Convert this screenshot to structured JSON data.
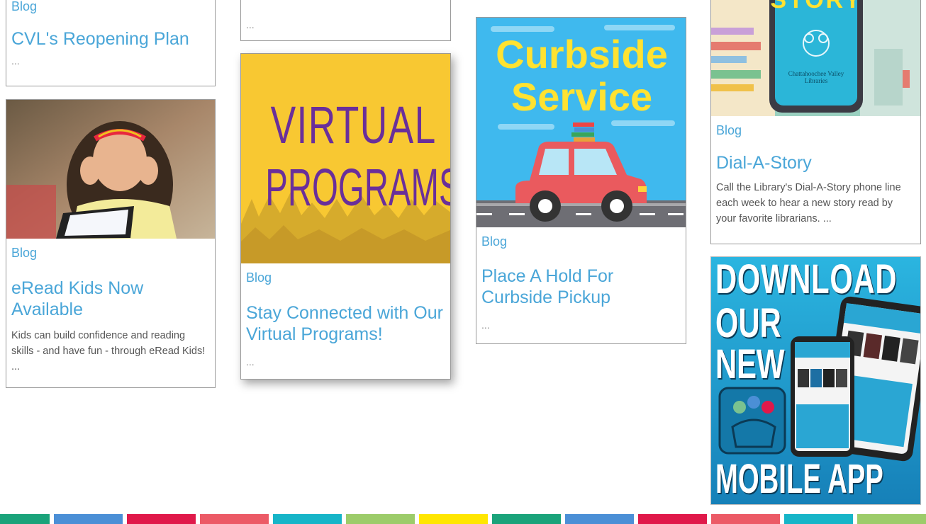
{
  "cards": {
    "reopening": {
      "category": "Blog",
      "title": "CVL's Reopening Plan",
      "excerpt": "..."
    },
    "top_mid": {
      "excerpt": "..."
    },
    "eread": {
      "category": "Blog",
      "title": "eRead Kids Now Available",
      "excerpt": "Kids can build confidence and reading skills - and have fun - through eRead Kids! ..."
    },
    "virtual": {
      "category": "Blog",
      "title": "Stay Connected with Our Virtual Programs!",
      "excerpt": "...",
      "image_text_1": "VIRTUAL",
      "image_text_2": "PROGRAMS"
    },
    "curbside": {
      "category": "Blog",
      "title": "Place A Hold For Curbside Pickup",
      "excerpt": "...",
      "image_text_1": "Curbside",
      "image_text_2": "Service"
    },
    "dial": {
      "category": "Blog",
      "title": "Dial-A-Story",
      "excerpt": "Call the Library's Dial-A-Story phone line each week to hear a new story read by your favorite librarians. ...",
      "image_text": "STORY",
      "phone_text": "Chattahoochee Valley Libraries"
    },
    "app_ad": {
      "line1": "DOWNLOAD",
      "line2": "OUR",
      "line3": "NEW",
      "line4": "MOBILE APP"
    }
  },
  "colors": {
    "link": "#4aa6d8",
    "footer_bars": [
      "#1aa37a",
      "#4b8fd6",
      "#e0194a",
      "#ec5a66",
      "#16b5c8",
      "#9ccc6a",
      "#ffe600",
      "#1aa37a",
      "#4b8fd6",
      "#e0194a",
      "#ec5a66",
      "#16b5c8",
      "#9ccc6a"
    ]
  }
}
